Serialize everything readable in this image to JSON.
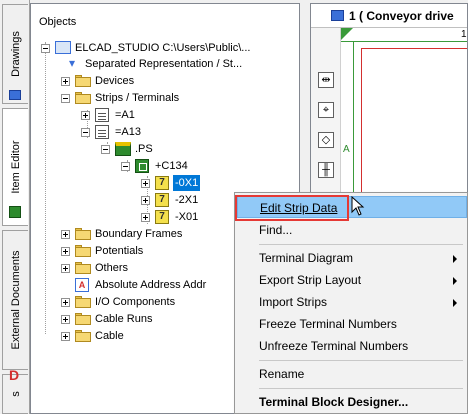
{
  "tabs": [
    {
      "label": "Drawings",
      "icon": "drawings-icon"
    },
    {
      "label": "Item Editor",
      "icon": "item-editor-icon"
    },
    {
      "label": "External Documents",
      "icon": "external-documents-icon"
    },
    {
      "label": "s",
      "icon": ""
    }
  ],
  "tree": {
    "title": "Objects",
    "root": "ELCAD_STUDIO C:\\Users\\Public\\...",
    "items": {
      "separated": "Separated Representation / St...",
      "devices": "Devices",
      "strips": "Strips / Terminals",
      "a1": "=A1",
      "a13": "=A13",
      "ps": ".PS",
      "c134": "+C134",
      "x1_0": "-0X1",
      "x1_2": "-2X1",
      "x01": "-X01",
      "boundary": "Boundary Frames",
      "potentials": "Potentials",
      "others": "Others",
      "absolute": "Absolute Address Addr",
      "io": "I/O Components",
      "cableruns": "Cable Runs",
      "cable": "Cable"
    },
    "strip_number": "7"
  },
  "drawing": {
    "title": "1 ( Conveyor drive",
    "sheet_number": "1",
    "grid_label": "A"
  },
  "menu": {
    "items": [
      {
        "label": "Edit Strip Data",
        "shortcut_char": "E"
      },
      {
        "label": "Find..."
      },
      {
        "label": "Terminal Diagram"
      },
      {
        "label": "Export Strip Layout"
      },
      {
        "label": "Import Strips"
      },
      {
        "label": "Freeze Terminal Numbers"
      },
      {
        "label": "Unfreeze Terminal Numbers"
      },
      {
        "label": "Rename"
      },
      {
        "label": "Terminal Block Designer..."
      }
    ]
  },
  "colors": {
    "highlight": "#91c9f7",
    "selection": "#0078d7",
    "callout": "#e53935"
  }
}
